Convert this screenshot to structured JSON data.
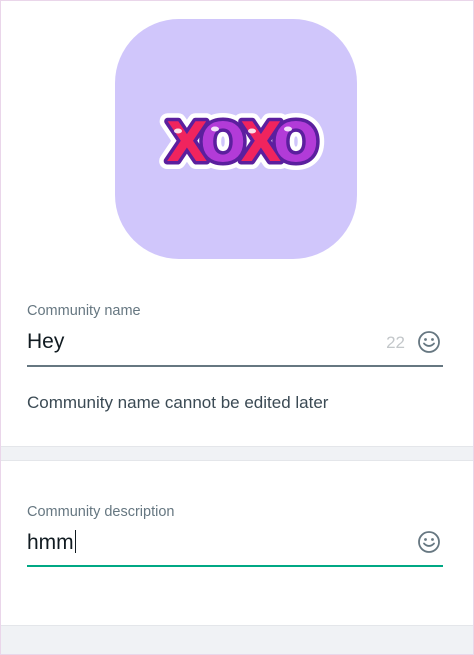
{
  "community_icon": {
    "sticker_text": "XOXO",
    "colors": {
      "tile_background": "#d0c6fb",
      "letter_x": "#f0245e",
      "letter_o": "#b23bd8",
      "outline": "#5b1f9e"
    }
  },
  "name_field": {
    "label": "Community name",
    "value": "Hey",
    "remaining_count": "22",
    "emoji_icon": "smiley-icon",
    "helper_text": "Community name cannot be edited later"
  },
  "description_field": {
    "label": "Community description",
    "value": "hmm",
    "emoji_icon": "smiley-icon"
  },
  "colors": {
    "accent": "#00a884",
    "underline": "#667781",
    "page_background": "#f0f2f5"
  }
}
